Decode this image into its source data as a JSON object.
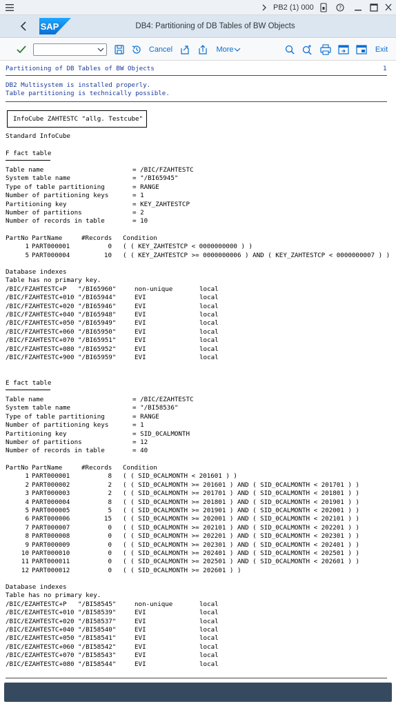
{
  "system": {
    "id": "PB2 (1) 000"
  },
  "shell": {
    "title": "DB4: Partitioning of DB Tables of BW Objects",
    "logo_text": "SAP"
  },
  "toolbar": {
    "command_value": "",
    "cancel_label": "Cancel",
    "more_label": "More",
    "exit_label": "Exit"
  },
  "report": {
    "heading": "Partitioning of DB Tables of BW Objects",
    "page_number": "1",
    "info_line1": "DB2 Multisystem is installed properly.",
    "info_line2": "Table partitioning is technically possible.",
    "infocube": "InfoCube ZAHTESTC \"allg. Testcube\"",
    "cube_type": "Standard InfoCube",
    "f_table": {
      "title": "F fact table",
      "props": [
        [
          "Table name",
          "= /BIC/FZAHTESTC"
        ],
        [
          "System table name",
          "= \"/BI65945\""
        ],
        [
          "Type of table partitioning",
          "= RANGE"
        ],
        [
          "Number of partitioning keys",
          "= 1"
        ],
        [
          "Partitioning key",
          "= KEY_ZAHTESTCP"
        ],
        [
          "Number of partitions",
          "= 2"
        ],
        [
          "Number of records in table",
          "= 10"
        ]
      ],
      "header": [
        "PartNo",
        "PartName",
        "#Records",
        "Condition"
      ],
      "partitions": [
        [
          "1",
          "PART000001",
          "0",
          "( ( KEY_ZAHTESTCP < 0000000000 ) )"
        ],
        [
          "5",
          "PART000004",
          "10",
          "( ( KEY_ZAHTESTCP >= 0000000006 ) AND ( KEY_ZAHTESTCP < 0000000007 ) )"
        ]
      ],
      "indexes_title": "Database indexes",
      "primary_key_note": "Table has no primary key.",
      "indexes": [
        [
          "/BIC/FZAHTESTC+P",
          "\"/BI65960\"",
          "non-unique",
          "local"
        ],
        [
          "/BIC/FZAHTESTC+010",
          "\"/BI65944\"",
          "EVI",
          "local"
        ],
        [
          "/BIC/FZAHTESTC+020",
          "\"/BI65946\"",
          "EVI",
          "local"
        ],
        [
          "/BIC/FZAHTESTC+040",
          "\"/BI65948\"",
          "EVI",
          "local"
        ],
        [
          "/BIC/FZAHTESTC+050",
          "\"/BI65949\"",
          "EVI",
          "local"
        ],
        [
          "/BIC/FZAHTESTC+060",
          "\"/BI65950\"",
          "EVI",
          "local"
        ],
        [
          "/BIC/FZAHTESTC+070",
          "\"/BI65951\"",
          "EVI",
          "local"
        ],
        [
          "/BIC/FZAHTESTC+080",
          "\"/BI65952\"",
          "EVI",
          "local"
        ],
        [
          "/BIC/FZAHTESTC+900",
          "\"/BI65959\"",
          "EVI",
          "local"
        ]
      ]
    },
    "e_table": {
      "title": "E fact table",
      "props": [
        [
          "Table name",
          "= /BIC/EZAHTESTC"
        ],
        [
          "System table name",
          "= \"/BI58536\""
        ],
        [
          "Type of table partitioning",
          "= RANGE"
        ],
        [
          "Number of partitioning keys",
          "= 1"
        ],
        [
          "Partitioning key",
          "= SID_0CALMONTH"
        ],
        [
          "Number of partitions",
          "= 12"
        ],
        [
          "Number of records in table",
          "= 40"
        ]
      ],
      "header": [
        "PartNo",
        "PartName",
        "#Records",
        "Condition"
      ],
      "partitions": [
        [
          "1",
          "PART000001",
          "8",
          "( ( SID_0CALMONTH < 201601 ) )"
        ],
        [
          "2",
          "PART000002",
          "2",
          "( ( SID_0CALMONTH >= 201601 ) AND ( SID_0CALMONTH < 201701 ) )"
        ],
        [
          "3",
          "PART000003",
          "2",
          "( ( SID_0CALMONTH >= 201701 ) AND ( SID_0CALMONTH < 201801 ) )"
        ],
        [
          "4",
          "PART000004",
          "8",
          "( ( SID_0CALMONTH >= 201801 ) AND ( SID_0CALMONTH < 201901 ) )"
        ],
        [
          "5",
          "PART000005",
          "5",
          "( ( SID_0CALMONTH >= 201901 ) AND ( SID_0CALMONTH < 202001 ) )"
        ],
        [
          "6",
          "PART000006",
          "15",
          "( ( SID_0CALMONTH >= 202001 ) AND ( SID_0CALMONTH < 202101 ) )"
        ],
        [
          "7",
          "PART000007",
          "0",
          "( ( SID_0CALMONTH >= 202101 ) AND ( SID_0CALMONTH < 202201 ) )"
        ],
        [
          "8",
          "PART000008",
          "0",
          "( ( SID_0CALMONTH >= 202201 ) AND ( SID_0CALMONTH < 202301 ) )"
        ],
        [
          "9",
          "PART000009",
          "0",
          "( ( SID_0CALMONTH >= 202301 ) AND ( SID_0CALMONTH < 202401 ) )"
        ],
        [
          "10",
          "PART000010",
          "0",
          "( ( SID_0CALMONTH >= 202401 ) AND ( SID_0CALMONTH < 202501 ) )"
        ],
        [
          "11",
          "PART000011",
          "0",
          "( ( SID_0CALMONTH >= 202501 ) AND ( SID_0CALMONTH < 202601 ) )"
        ],
        [
          "12",
          "PART000012",
          "0",
          "( ( SID_0CALMONTH >= 202601 ) )"
        ]
      ],
      "indexes_title": "Database indexes",
      "primary_key_note": "Table has no primary key.",
      "indexes": [
        [
          "/BIC/EZAHTESTC+P",
          "\"/BI58545\"",
          "non-unique",
          "local"
        ],
        [
          "/BIC/EZAHTESTC+010",
          "\"/BI58539\"",
          "EVI",
          "local"
        ],
        [
          "/BIC/EZAHTESTC+020",
          "\"/BI58537\"",
          "EVI",
          "local"
        ],
        [
          "/BIC/EZAHTESTC+040",
          "\"/BI58540\"",
          "EVI",
          "local"
        ],
        [
          "/BIC/EZAHTESTC+050",
          "\"/BI58541\"",
          "EVI",
          "local"
        ],
        [
          "/BIC/EZAHTESTC+060",
          "\"/BI58542\"",
          "EVI",
          "local"
        ],
        [
          "/BIC/EZAHTESTC+070",
          "\"/BI58543\"",
          "EVI",
          "local"
        ],
        [
          "/BIC/EZAHTESTC+080",
          "\"/BI58544\"",
          "EVI",
          "local"
        ]
      ]
    }
  },
  "colors": {
    "shell": "#dbe6f1",
    "link": "#0a6ed1",
    "footer": "#354a5f",
    "info_text": "#1a3a9b"
  }
}
